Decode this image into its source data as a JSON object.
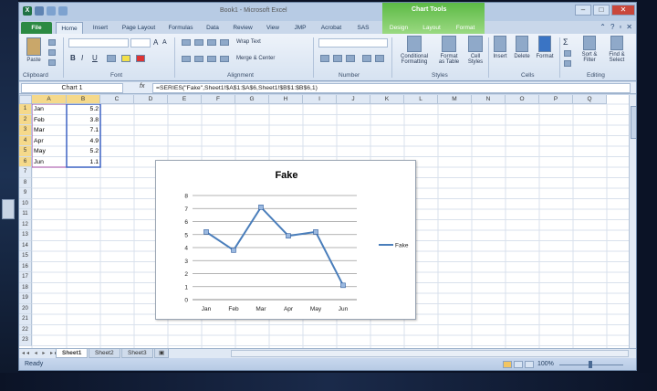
{
  "app": {
    "title": "Book1 - Microsoft Excel",
    "logo": "X"
  },
  "context_tab": {
    "label": "Chart Tools"
  },
  "tabs": [
    {
      "label": "File",
      "active": false
    },
    {
      "label": "Home",
      "active": true
    },
    {
      "label": "Insert"
    },
    {
      "label": "Page Layout"
    },
    {
      "label": "Formulas"
    },
    {
      "label": "Data"
    },
    {
      "label": "Review"
    },
    {
      "label": "View"
    },
    {
      "label": "JMP"
    },
    {
      "label": "Acrobat"
    },
    {
      "label": "SAS"
    },
    {
      "label": "Design"
    },
    {
      "label": "Layout"
    },
    {
      "label": "Format"
    }
  ],
  "ribbon": {
    "groups": [
      "Clipboard",
      "Font",
      "Alignment",
      "Number",
      "Styles",
      "Cells",
      "Editing"
    ],
    "clipboard": {
      "paste": "Paste"
    },
    "font": {
      "grow": "A",
      "shrink": "A",
      "bold": "B",
      "italic": "I",
      "underline": "U"
    },
    "alignment": {
      "wrap_text": "Wrap Text",
      "merge_center": "Merge & Center"
    },
    "styles": {
      "conditional": "Conditional",
      "formatting": "Formatting",
      "format_as": "Format",
      "as_table": "as Table",
      "cell": "Cell",
      "styles": "Styles"
    },
    "cells": {
      "insert": "Insert",
      "delete": "Delete",
      "format": "Format"
    },
    "editing": {
      "sigma": "Σ",
      "sort": "Sort &",
      "filter": "Filter",
      "find": "Find &",
      "select": "Select"
    }
  },
  "formula_bar": {
    "name_box": "Chart 1",
    "fx": "fx",
    "formula": "=SERIES(\"Fake\",Sheet1!$A$1:$A$6,Sheet1!$B$1:$B$6,1)"
  },
  "columns": [
    "A",
    "B",
    "C",
    "D",
    "E",
    "F",
    "G",
    "H",
    "I",
    "J",
    "K",
    "L",
    "M",
    "N",
    "O",
    "P",
    "Q"
  ],
  "rows": [
    "1",
    "2",
    "3",
    "4",
    "5",
    "6",
    "7",
    "8",
    "9",
    "10",
    "11",
    "12",
    "13",
    "14",
    "15",
    "16",
    "17",
    "18",
    "19",
    "20",
    "21",
    "22",
    "23"
  ],
  "cells": [
    {
      "a": "Jan",
      "b": "5.2"
    },
    {
      "a": "Feb",
      "b": "3.8"
    },
    {
      "a": "Mar",
      "b": "7.1"
    },
    {
      "a": "Apr",
      "b": "4.9"
    },
    {
      "a": "May",
      "b": "5.2"
    },
    {
      "a": "Jun",
      "b": "1.1"
    }
  ],
  "chart_data": {
    "type": "line",
    "title": "Fake",
    "categories": [
      "Jan",
      "Feb",
      "Mar",
      "Apr",
      "May",
      "Jun"
    ],
    "series": [
      {
        "name": "Fake",
        "values": [
          5.2,
          3.8,
          7.1,
          4.9,
          5.2,
          1.1
        ],
        "color": "#4a7ebb"
      }
    ],
    "ylim": [
      0,
      8
    ],
    "yticks": [
      "0",
      "1",
      "2",
      "3",
      "4",
      "5",
      "6",
      "7",
      "8"
    ],
    "grid": true,
    "legend": "right"
  },
  "sheets": [
    {
      "label": "Sheet1",
      "active": true
    },
    {
      "label": "Sheet2"
    },
    {
      "label": "Sheet3"
    }
  ],
  "status": {
    "ready": "Ready",
    "zoom": "100%"
  },
  "colors": {
    "excel_green": "#207245",
    "chart_tools": "#5cba45",
    "series_blue": "#4a7ebb",
    "selection": "#f5d98b"
  }
}
